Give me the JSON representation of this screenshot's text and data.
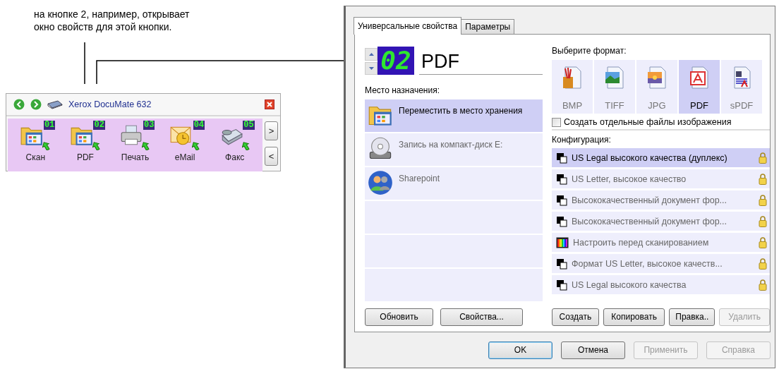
{
  "caption": {
    "text": "на кнопке 2, например, открывает окно свойств для этой кнопки."
  },
  "toolbar": {
    "title": "Xerox DocuMate 632",
    "buttons": [
      {
        "label": "Скан",
        "number": "01",
        "kind": "folder"
      },
      {
        "label": "PDF",
        "number": "02",
        "kind": "folder"
      },
      {
        "label": "Печать",
        "number": "03",
        "kind": "printer"
      },
      {
        "label": "eMail",
        "number": "04",
        "kind": "email"
      },
      {
        "label": "Факс",
        "number": "05",
        "kind": "fax"
      }
    ],
    "scroll_buttons": [
      ">",
      "<"
    ]
  },
  "dialog": {
    "tabs": [
      {
        "label": "Универсальные свойства",
        "selected": true
      },
      {
        "label": "Параметры",
        "selected": false
      }
    ],
    "button_number": "02",
    "button_name": "PDF",
    "destination_label": "Место назначения:",
    "destinations": [
      {
        "label": "Переместить в место хранения",
        "selected": true,
        "kind": "folder"
      },
      {
        "label": "Запись на компакт-диск  E:",
        "selected": false,
        "kind": "cd"
      },
      {
        "label": "Sharepoint",
        "selected": false,
        "kind": "people"
      }
    ],
    "destination_buttons": [
      "Обновить",
      "Свойства..."
    ],
    "format_label": "Выберите формат:",
    "formats": [
      {
        "label": "BMP",
        "selected": false,
        "kind": "bmp"
      },
      {
        "label": "TIFF",
        "selected": false,
        "kind": "tiff"
      },
      {
        "label": "JPG",
        "selected": false,
        "kind": "jpg"
      },
      {
        "label": "PDF",
        "selected": true,
        "kind": "pdf"
      },
      {
        "label": "sPDF",
        "selected": false,
        "kind": "spdf"
      }
    ],
    "checkbox": {
      "label": "Создать отдельные файлы изображения",
      "checked": false
    },
    "config_label": "Конфигурация:",
    "configs": [
      {
        "label": "US Legal высокого качества (дуплекс)",
        "selected": true,
        "kind": "mono"
      },
      {
        "label": "US Letter, высокое качество",
        "selected": false,
        "kind": "mono"
      },
      {
        "label": "Высококачественный документ фор...",
        "selected": false,
        "kind": "mono"
      },
      {
        "label": "Высококачественный документ фор...",
        "selected": false,
        "kind": "mono"
      },
      {
        "label": "Настроить перед сканированием",
        "selected": false,
        "kind": "color"
      },
      {
        "label": "Формат US Letter, высокое качеств...",
        "selected": false,
        "kind": "mono"
      },
      {
        "label": "US Legal высокого качества",
        "selected": false,
        "kind": "mono"
      }
    ],
    "config_buttons": [
      {
        "label": "Создать",
        "disabled": false
      },
      {
        "label": "Копировать",
        "disabled": false
      },
      {
        "label": "Правка..",
        "disabled": false
      },
      {
        "label": "Удалить",
        "disabled": true
      }
    ],
    "footer_buttons": [
      {
        "label": "OK",
        "disabled": false,
        "default": true
      },
      {
        "label": "Отмена",
        "disabled": false,
        "default": false
      },
      {
        "label": "Применить",
        "disabled": true,
        "default": false
      },
      {
        "label": "Справка",
        "disabled": true,
        "default": false
      }
    ]
  }
}
